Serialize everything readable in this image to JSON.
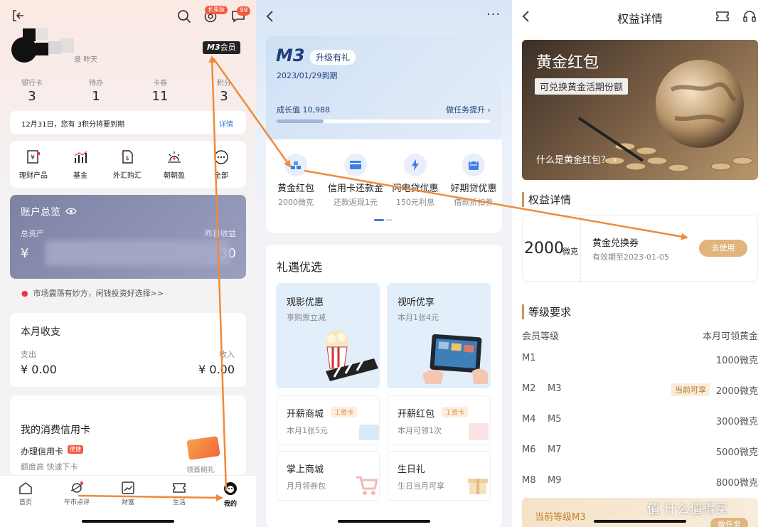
{
  "p1": {
    "login_suffix": "录 昨天",
    "badge_long": "长辈版",
    "msg_count": "99",
    "member_m3": "M3",
    "member_label": "会员",
    "stats": [
      {
        "label": "银行卡",
        "value": "3"
      },
      {
        "label": "待办",
        "value": "1"
      },
      {
        "label": "卡券",
        "value": "11"
      },
      {
        "label": "积分",
        "value": "3"
      }
    ],
    "notice": "12月31日，您有 3积分将要到期",
    "notice_link": "详情",
    "quick": [
      "理财产品",
      "基金",
      "外汇购汇",
      "朝朝盈",
      "全部"
    ],
    "account_title": "账户总览",
    "total_assets": "总资产",
    "yesterday": "昨日收益",
    "yuan": "¥",
    "yest_tail": "30",
    "market_tip": "市场震荡有妙方，闲钱投资好选择>>",
    "monthly_title": "本月收支",
    "expense": "支出",
    "income": "收入",
    "expense_val": "¥ 0.00",
    "income_val": "¥ 0.00",
    "credit_title": "我的消费信用卡",
    "apply_card": "办理信用卡",
    "apply_tag": "便捷",
    "apply_desc": "额度高 快速下卡",
    "first_swipe": "领首刷礼",
    "tabs": [
      "首页",
      "午市点评",
      "财富",
      "生活",
      "我的"
    ]
  },
  "p2": {
    "m3": "M3",
    "upgrade": "升级有礼",
    "expire": "2023/01/29到期",
    "growth": "成长值 10,988",
    "task": "做任务提升",
    "benefits": [
      {
        "title": "黄金红包",
        "sub": "2000微克"
      },
      {
        "title": "信用卡还款金",
        "sub": "还款返现1元"
      },
      {
        "title": "闪电贷优惠",
        "sub": "150元利息"
      },
      {
        "title": "好期贷优惠",
        "sub": "借款折扣券"
      }
    ],
    "gift_title": "礼遇优选",
    "tiles": [
      {
        "title": "观影优惠",
        "sub": "享购票立减"
      },
      {
        "title": "视听优享",
        "sub": "本月1张4元"
      }
    ],
    "cards": [
      {
        "title": "开薪商城",
        "tag": "工资卡",
        "sub": "本月1张5元"
      },
      {
        "title": "开薪红包",
        "tag": "工资卡",
        "sub": "本月可领1次"
      },
      {
        "title": "掌上商城",
        "tag": "",
        "sub": "月月领券包"
      },
      {
        "title": "生日礼",
        "tag": "",
        "sub": "生日当月可享"
      }
    ]
  },
  "p3": {
    "title": "权益详情",
    "banner_title": "黄金红包",
    "banner_sub": "可兑换黄金活期份额",
    "banner_q": "什么是黄金红包？",
    "section1": "权益详情",
    "amount": "2000",
    "unit": "微克",
    "coupon_title": "黄金兑换券",
    "coupon_valid": "有效期至2023-01-05",
    "use_btn": "去使用",
    "section2": "等级要求",
    "col_left": "会员等级",
    "col_right": "本月可领黄金",
    "levels": [
      {
        "a": "M1",
        "b": "",
        "cur": "",
        "amt": "1000微克"
      },
      {
        "a": "M2",
        "b": "M3",
        "cur": "当前可享",
        "amt": "2000微克"
      },
      {
        "a": "M4",
        "b": "M5",
        "cur": "",
        "amt": "3000微克"
      },
      {
        "a": "M6",
        "b": "M7",
        "cur": "",
        "amt": "5000微克"
      },
      {
        "a": "M8",
        "b": "M9",
        "cur": "",
        "amt": "8000微克"
      }
    ],
    "current_level": "当前等级M3",
    "do_task": "做任务",
    "watermark": "值 什么值得买"
  }
}
